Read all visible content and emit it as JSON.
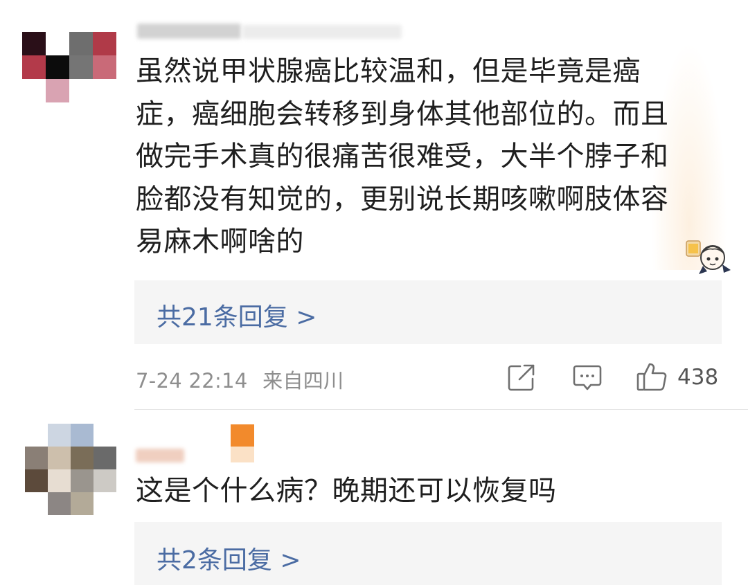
{
  "comments": [
    {
      "text_lines": [
        "虽然说甲状腺癌比较温和，但是毕竟是癌",
        "症，癌细胞会转移到身体其他部位的。而且",
        "做完手术真的很痛苦很难受，大半个脖子和",
        "脸都没有知觉的，更别说长期咳嗽啊肢体容",
        "易麻木啊啥的"
      ],
      "replies_label": "共21条回复 >",
      "time": "7-24 22:14",
      "location": "来自四川",
      "likes": "438"
    },
    {
      "text_lines": [
        "这是个什么病？晚期还可以恢复吗"
      ],
      "replies_label": "共2条回复 >"
    }
  ],
  "icons": {
    "share": "share-icon",
    "comment": "comment-icon",
    "like": "thumbs-up-icon",
    "sticker": "sticker-icon"
  },
  "colors": {
    "reply_link": "#4b6ca3",
    "reply_bg": "#f5f5f5",
    "meta_text": "#8e8e8e"
  }
}
